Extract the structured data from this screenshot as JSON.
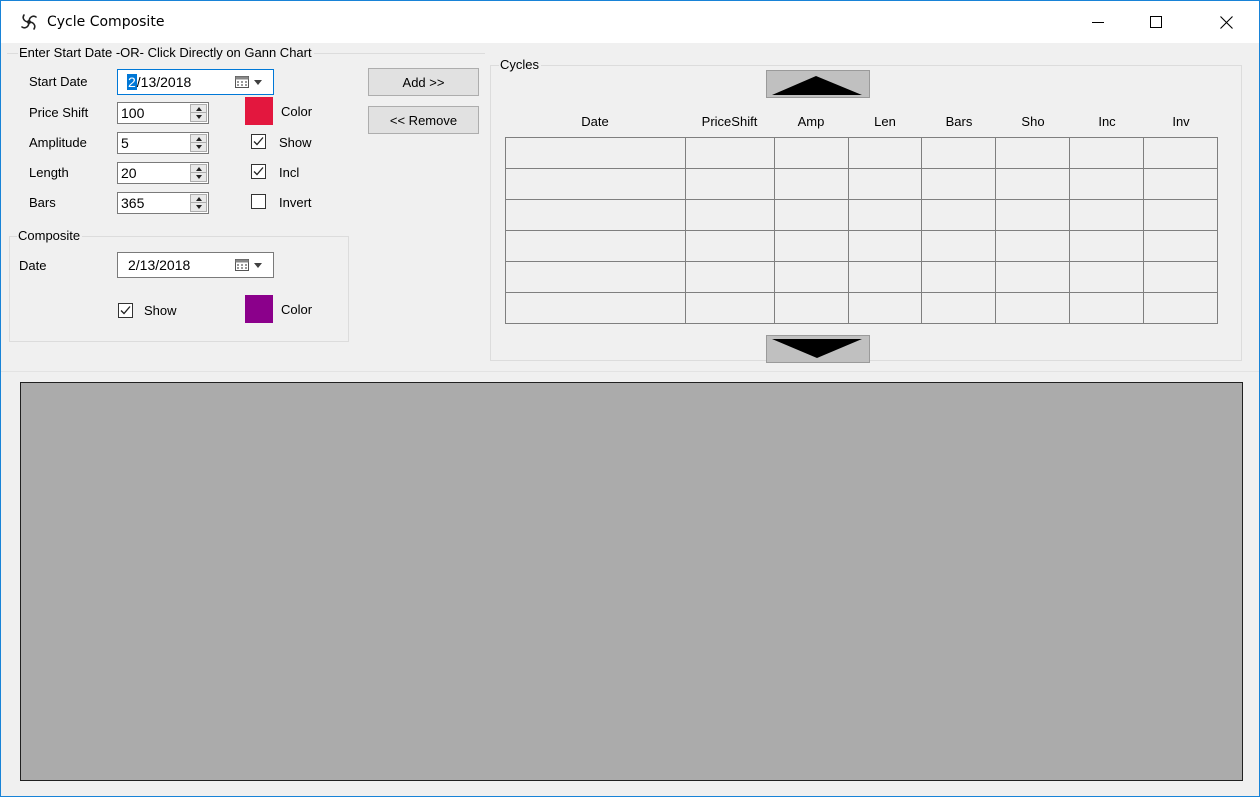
{
  "window": {
    "title": "Cycle Composite",
    "icon": "spiral-app-icon",
    "controls": [
      "minimize-icon",
      "maximize-icon",
      "close-icon"
    ]
  },
  "start_group": {
    "title": "Enter Start Date -OR- Click Directly on Gann Chart",
    "start_date_label": "Start Date",
    "start_date_selected": "2",
    "start_date_rest": "/13/2018",
    "price_shift_label": "Price Shift",
    "price_shift_value": "100",
    "amplitude_label": "Amplitude",
    "amplitude_value": "5",
    "length_label": "Length",
    "length_value": "20",
    "bars_label": "Bars",
    "bars_value": "365",
    "color_label": "Color",
    "color_value": "#e3173e",
    "show_label": "Show",
    "show_checked": true,
    "incl_label": "Incl",
    "incl_checked": true,
    "invert_label": "Invert",
    "invert_checked": false
  },
  "composite_group": {
    "title": "Composite",
    "date_label": "Date",
    "date_value": "2/13/2018",
    "show_label": "Show",
    "show_checked": true,
    "color_label": "Color",
    "color_value": "#8b008b"
  },
  "actions": {
    "add_label": "Add >>",
    "remove_label": "<< Remove"
  },
  "cycles_group": {
    "title": "Cycles",
    "columns": [
      "Date",
      "PriceShift",
      "Amp",
      "Len",
      "Bars",
      "Sho",
      "Inc",
      "Inv"
    ],
    "row_count": 6,
    "scroll_up_icon": "scroll-up-icon",
    "scroll_down_icon": "scroll-down-icon"
  },
  "chart": {
    "background": "#ababab"
  }
}
